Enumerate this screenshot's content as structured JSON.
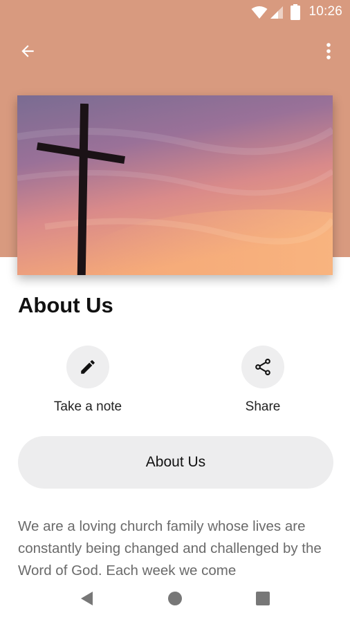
{
  "status_bar": {
    "time": "10:26"
  },
  "colors": {
    "header": "#d89a7f",
    "button_bg": "#eeeeef",
    "body_text": "#6a6a6a"
  },
  "app_bar": {
    "back_icon": "arrow-back-icon",
    "menu_icon": "more-vert-icon"
  },
  "hero": {
    "image": "wooden-cross-sunset-sky"
  },
  "page": {
    "title": "About Us"
  },
  "actions": [
    {
      "label": "Take a note",
      "icon": "pencil-icon"
    },
    {
      "label": "Share",
      "icon": "share-icon"
    }
  ],
  "section_button": {
    "label": "About Us"
  },
  "body": {
    "text": "We are a loving church family whose lives are constantly being changed and challenged by the Word of God. Each week we come"
  },
  "nav_bar": {
    "icons": [
      "back-triangle-icon",
      "home-circle-icon",
      "recents-square-icon"
    ]
  }
}
